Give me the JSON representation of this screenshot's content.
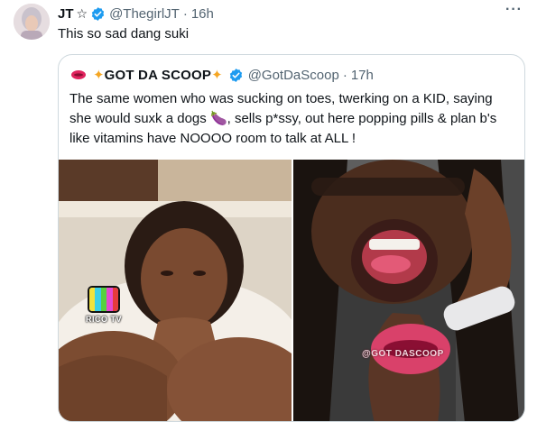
{
  "tweet": {
    "author_name": "JT",
    "author_handle": "@ThegirlJT",
    "separator": "·",
    "time": "16h",
    "text": "This so sad dang suki",
    "more_icon": "more-icon"
  },
  "quoted_tweet": {
    "author_name": "GOT DA SCOOP",
    "author_handle": "@GotDaScoop",
    "separator": "·",
    "time": "17h",
    "text_before_emoji": "The same women who was sucking on toes, twerking on a KID, saying she would suxk a dogs ",
    "emoji": "🍆",
    "text_after_emoji": ", sells p*ssy, out here popping pills & plan b's like vitamins have NOOOO room to talk at ALL !"
  },
  "media": {
    "left_watermark": "RICO TV",
    "right_watermark": "@GOT DASCOOP"
  },
  "colors": {
    "verified": "#1d9bf0",
    "secondary_text": "#536471",
    "border": "#cfd9de",
    "sparkle": "#f5a623"
  }
}
